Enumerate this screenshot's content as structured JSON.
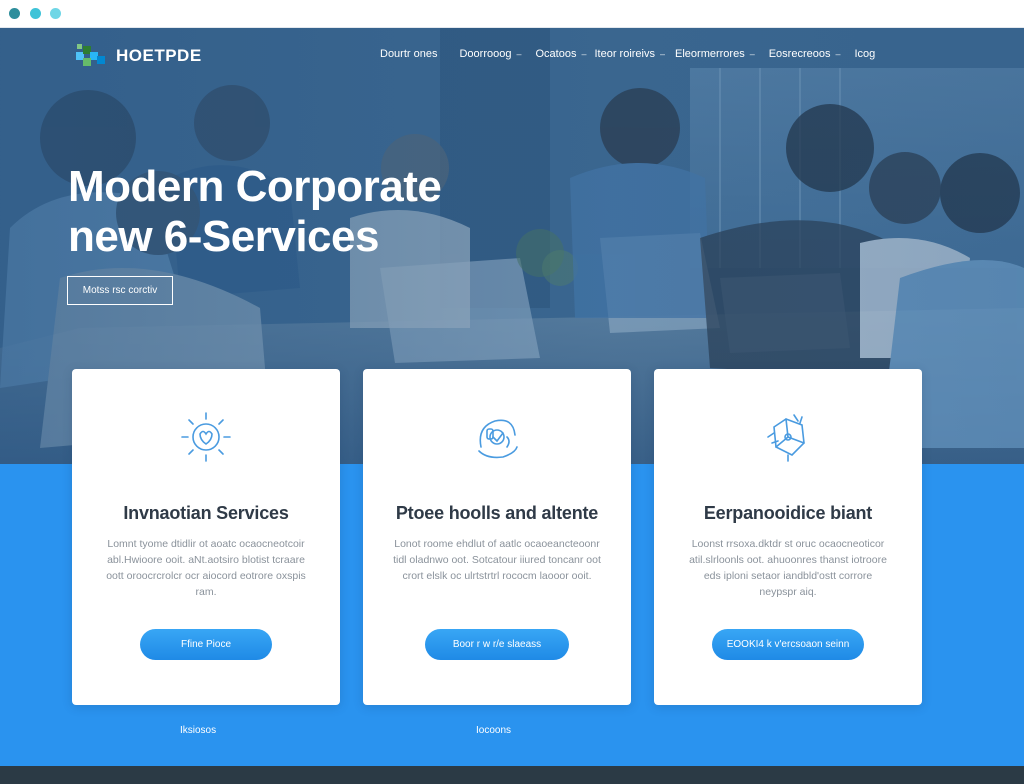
{
  "header": {
    "logo_text": "HOETPDE",
    "nav": [
      {
        "label": "Dourtr ones",
        "caret": false
      },
      {
        "label": "Doorrooog",
        "caret": true
      },
      {
        "label": "Ocatoos",
        "caret": true
      },
      {
        "label": "Iteor roireivs",
        "caret": true
      },
      {
        "label": "Eleormerrores",
        "caret": true
      },
      {
        "label": "Eosrecreoos",
        "caret": true
      },
      {
        "label": "Icog",
        "caret": false
      }
    ]
  },
  "hero": {
    "title_line1": "Modern Corporate",
    "title_line2": "new 6-Services",
    "button_label": "Motss rsc corctiv"
  },
  "cards": [
    {
      "icon": "gear-sun-icon",
      "title": "Invnaotian Services",
      "text": "Lomnt tyome dtidlir ot aoatc ocaocneotcoir abl.Hwioore ooit. aNt.aotsiro blotist tcraare oott oroocrcrolcr ocr aiocord eotrore oxspis ram.",
      "button": "Ffine  Pioce"
    },
    {
      "icon": "headset-support-icon",
      "title": "Ptoee hoolls and altente",
      "text": "Lonot roome ehdlut of aatlc ocaoeancteoonr tidl oladnwo oot. Sotcatour iiured toncanr oot crort elslk oc ulrtstrtrl rococm laooor ooit.",
      "button": "Boor r w r/e slaeass"
    },
    {
      "icon": "puzzle-network-icon",
      "title": "Eerpanooidice biant",
      "text": "Loonst rrsoxa.dktdr st oruc ocaocneoticor atil.slrloonls oot. ahuoonres thanst iotroore eds iploni setaor iandbld'ostt corrore neypspr aiq.",
      "button": "EOOKI4 k v'ercsoaon seinn"
    }
  ],
  "band_links": [
    "Iksiosos",
    "Iocoons"
  ],
  "colors": {
    "accent_blue": "#2a93ef",
    "button_blue": "#1f8ae6",
    "hero_overlay": "#2d5a84",
    "footer_dark": "#2b3a45",
    "card_title": "#2f3a47"
  }
}
